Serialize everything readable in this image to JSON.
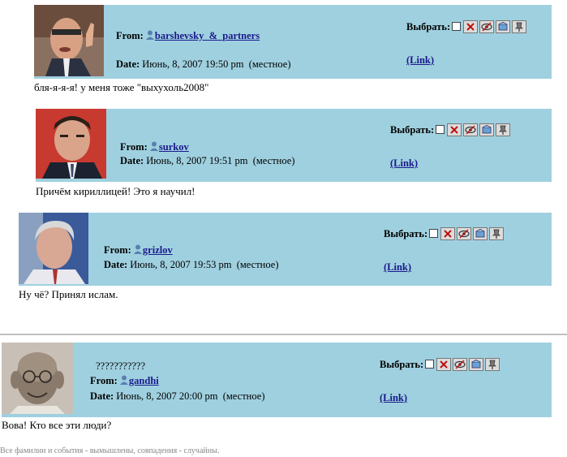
{
  "labels": {
    "from": "From:",
    "date": "Date:",
    "select": "Выбрать:",
    "link": "(Link)",
    "local": "(местное)"
  },
  "posts": [
    {
      "user": "barshevsky_&_partners",
      "date": "Июнь, 8, 2007 19:50 pm",
      "message": "бля-я-я-я! у меня тоже \"выхухоль2008\"",
      "extra": ""
    },
    {
      "user": "surkov",
      "date": "Июнь, 8, 2007 19:51 pm",
      "message": "Причём кириллицей! Это я научил!",
      "extra": ""
    },
    {
      "user": "grizlov",
      "date": "Июнь, 8, 2007 19:53 pm",
      "message": "Ну чё? Принял ислам.",
      "extra": ""
    },
    {
      "user": "gandhi",
      "date": "Июнь, 8, 2007 20:00 pm",
      "message": "Вова! Кто все эти люди?",
      "extra": "???????????"
    }
  ],
  "footer": "Все фамилии и события - вымышлены, совпадения - случайны.",
  "colors": {
    "bar": "#9fd0df",
    "link": "#1a1a8c"
  },
  "icons": [
    "delete-icon",
    "hide-icon",
    "move-icon",
    "pin-icon"
  ]
}
